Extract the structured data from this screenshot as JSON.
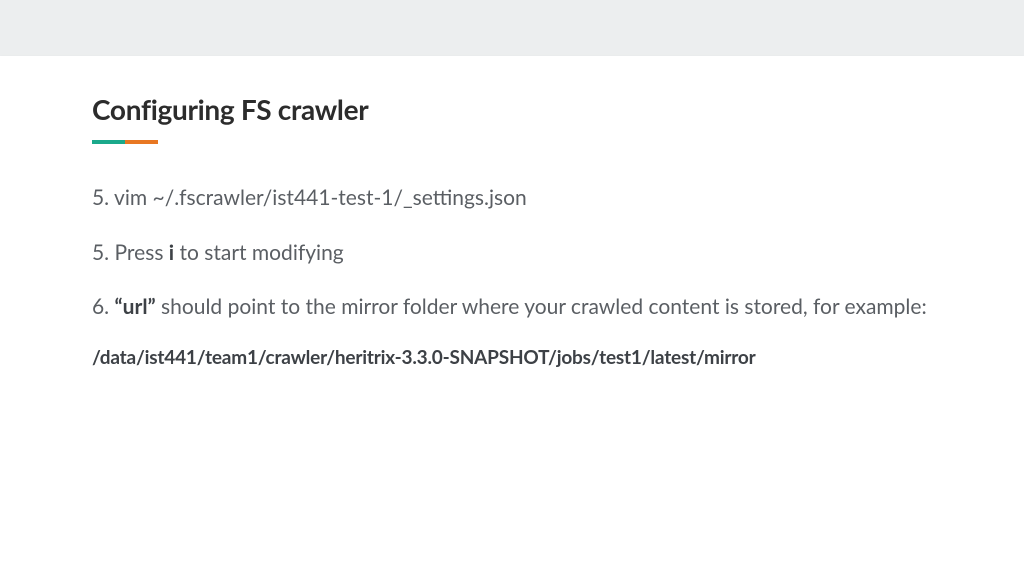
{
  "slide": {
    "title": "Configuring FS crawler",
    "accent": {
      "left": "#1aa98b",
      "right": "#e87722"
    },
    "steps": [
      {
        "num": "5.",
        "prefix": "",
        "bold": "",
        "text": "vim ~/.fscrawler/ist441-test-1/_settings.json"
      },
      {
        "num": "5.",
        "prefix": " Press ",
        "bold": "i",
        "text": " to start modifying"
      },
      {
        "num": "6.",
        "prefix": " ",
        "bold": "“url”",
        "text": " should point to the mirror folder where your crawled content is stored, for example:"
      }
    ],
    "example_path": "/data/ist441/team1/crawler/heritrix-3.3.0-SNAPSHOT/jobs/test1/latest/mirror"
  }
}
